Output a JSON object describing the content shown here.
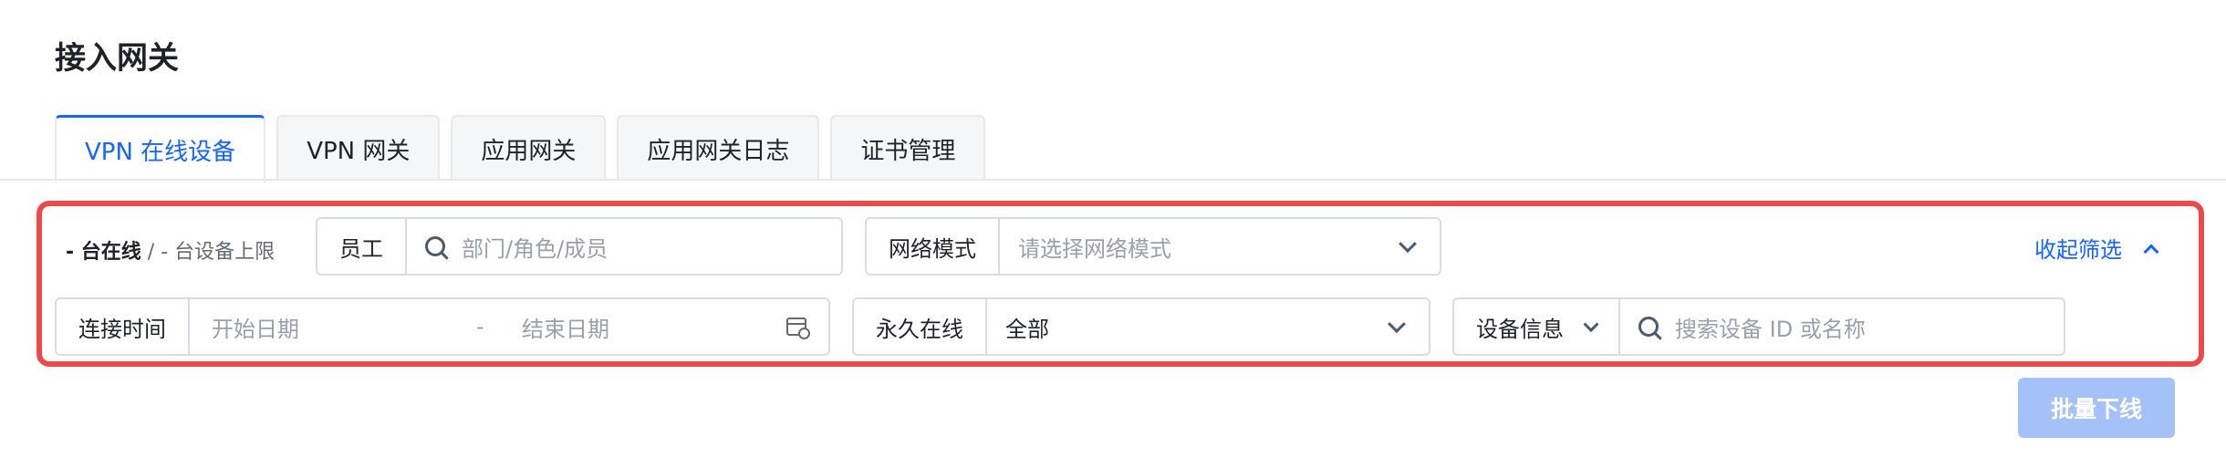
{
  "page": {
    "title": "接入网关"
  },
  "tabs": [
    {
      "label": "VPN 在线设备",
      "active": true
    },
    {
      "label": "VPN 网关",
      "active": false
    },
    {
      "label": "应用网关",
      "active": false
    },
    {
      "label": "应用网关日志",
      "active": false
    },
    {
      "label": "证书管理",
      "active": false
    }
  ],
  "filters": {
    "online": {
      "count_text": "- 台在线",
      "sep": " / ",
      "limit_text": "- 台设备上限"
    },
    "employee": {
      "label": "员工",
      "placeholder": "部门/角色/成员"
    },
    "network_mode": {
      "label": "网络模式",
      "placeholder": "请选择网络模式"
    },
    "collapse_label": "收起筛选",
    "connect_time": {
      "label": "连接时间",
      "start_placeholder": "开始日期",
      "separator": "-",
      "end_placeholder": "结束日期"
    },
    "permanent_online": {
      "label": "永久在线",
      "value": "全部"
    },
    "device_info": {
      "select_label": "设备信息",
      "placeholder": "搜索设备 ID 或名称"
    }
  },
  "actions": {
    "batch_offline_label": "批量下线",
    "batch_offline_disabled": true
  },
  "colors": {
    "accent": "#1664ff",
    "highlight_border": "#ec4a4a",
    "disabled_button": "#a4c2f8"
  }
}
